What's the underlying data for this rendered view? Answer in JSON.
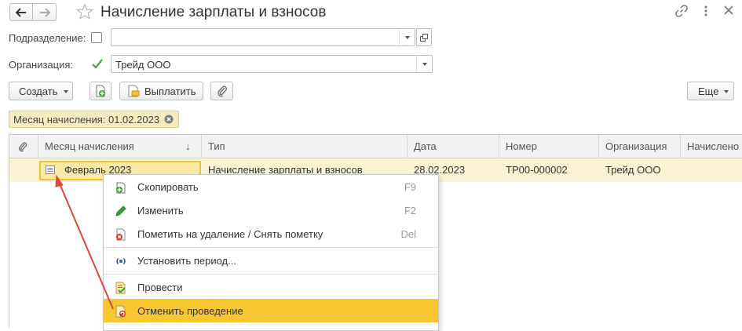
{
  "window": {
    "title": "Начисление зарплаты и взносов",
    "back_icon": "arrow-left-icon",
    "forward_icon": "arrow-right-icon"
  },
  "form": {
    "department": {
      "label": "Подразделение:",
      "checked": false,
      "value": ""
    },
    "organization": {
      "label": "Организация:",
      "checked": true,
      "value": "Трейд ООО"
    }
  },
  "toolbar": {
    "create_label": "Создать",
    "pay_label": "Выплатить",
    "more_label": "Еще"
  },
  "filter": {
    "text": "Месяц начисления: 01.02.2023"
  },
  "table": {
    "columns": [
      "Месяц начисления",
      "Тип",
      "Дата",
      "Номер",
      "Организация",
      "Начислено"
    ],
    "sort_indicator": "↓",
    "rows": [
      {
        "month": "Февраль 2023",
        "type": "Начисление зарплаты и взносов",
        "date": "28.02.2023",
        "number": "ТР00-000002",
        "organization": "Трейд ООО"
      }
    ]
  },
  "context_menu": {
    "items": [
      {
        "label": "Скопировать",
        "shortcut": "F9",
        "icon": "copy-icon"
      },
      {
        "label": "Изменить",
        "shortcut": "F2",
        "icon": "pencil-icon"
      },
      {
        "label": "Пометить на удаление / Снять пометку",
        "shortcut": "Del",
        "icon": "delete-mark-icon"
      },
      {
        "label": "Установить период...",
        "shortcut": "",
        "icon": "period-icon"
      },
      {
        "label": "Провести",
        "shortcut": "",
        "icon": "post-icon"
      },
      {
        "label": "Отменить проведение",
        "shortcut": "",
        "icon": "unpost-icon",
        "highlighted": true
      }
    ]
  },
  "colors": {
    "highlight": "#f8c62f",
    "selected_row": "#fbf3d4",
    "filter_tag": "#f5ebc0",
    "arrow": "#e0463b"
  }
}
